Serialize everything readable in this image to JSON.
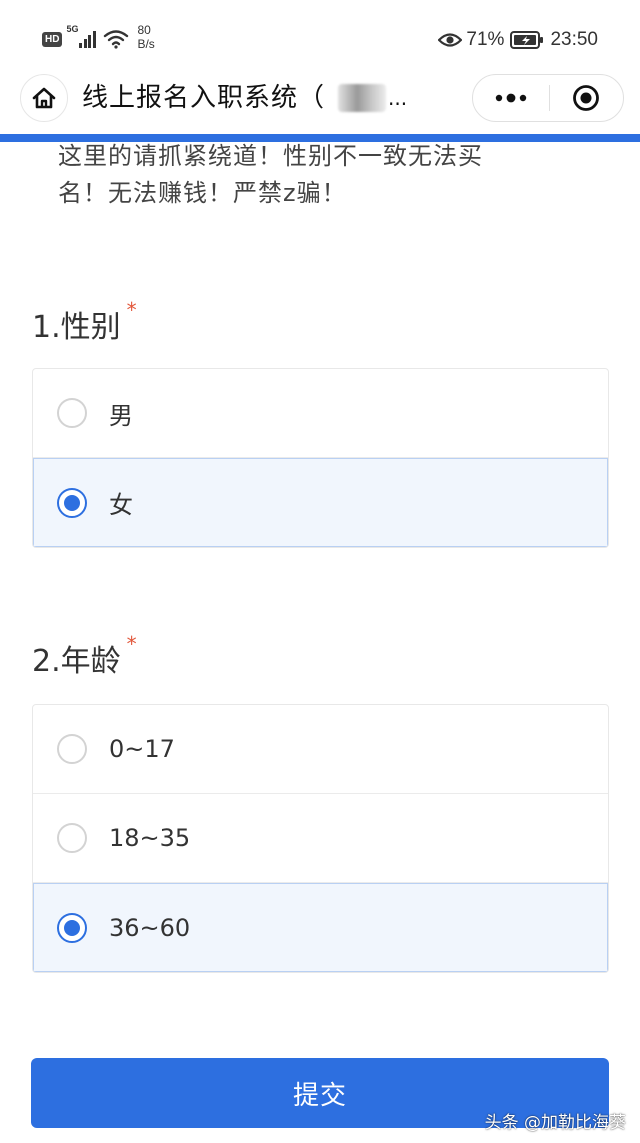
{
  "status_bar": {
    "hd_badge": "HD",
    "network_generation": "5G",
    "net_speed_value": "80",
    "net_speed_unit": "B/s",
    "battery_percent": "71%",
    "time": "23:50",
    "icons": [
      "signal-icon",
      "wifi-icon",
      "eye-icon",
      "battery-charging-icon"
    ]
  },
  "nav": {
    "title": "线上报名入职系统（",
    "title_truncation": "...",
    "icons": [
      "home-icon",
      "more-icon",
      "close-target-icon"
    ]
  },
  "notice": {
    "line1": "这里的请抓紧绕道！性别不一致无法买",
    "line2": "名！无法赚钱！严禁z骗！"
  },
  "questions": [
    {
      "title": "1.性别",
      "required_mark": "*",
      "options": [
        {
          "label": "男",
          "selected": false
        },
        {
          "label": "女",
          "selected": true
        }
      ]
    },
    {
      "title": "2.年龄",
      "required_mark": "*",
      "options": [
        {
          "label": "0~17",
          "selected": false
        },
        {
          "label": "18~35",
          "selected": false
        },
        {
          "label": "36~60",
          "selected": true
        }
      ]
    }
  ],
  "submit_label": "提交",
  "watermark": "头条 @加勒比海葵",
  "colors": {
    "accent": "#2d6fe0",
    "selected_bg": "#f1f6fd",
    "required": "#e2573b"
  }
}
